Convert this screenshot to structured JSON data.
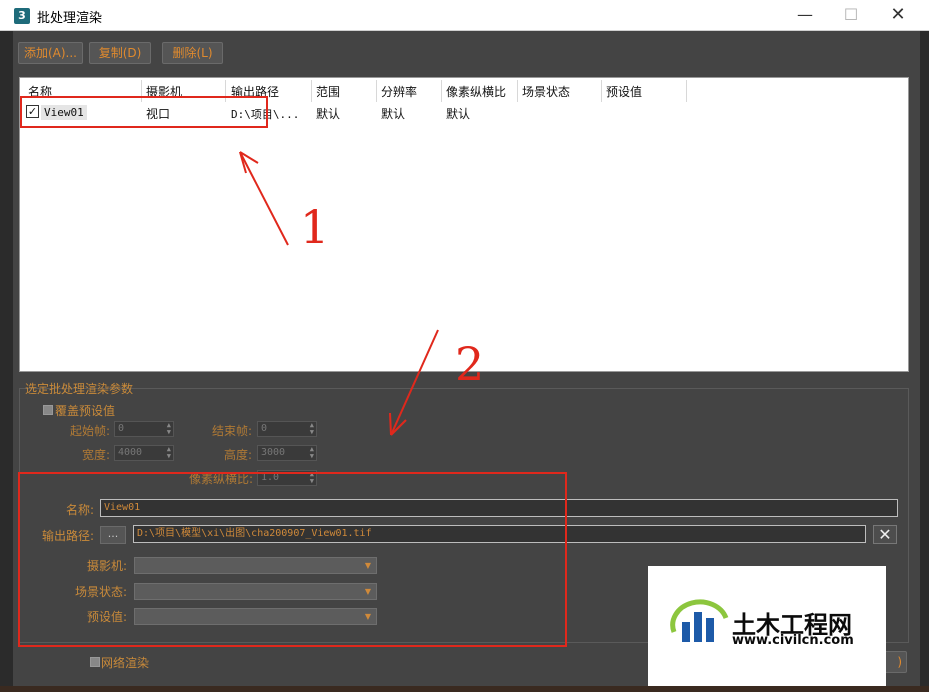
{
  "window": {
    "title": "批处理渲染",
    "icon_label": "3"
  },
  "toolbar": {
    "add_label": "添加(A)...",
    "copy_label": "复制(D)",
    "delete_label": "删除(L)"
  },
  "list": {
    "columns": [
      "名称",
      "摄影机",
      "输出路径",
      "范围",
      "分辨率",
      "像素纵横比",
      "场景状态",
      "预设值"
    ],
    "row": {
      "checked": "✓",
      "name": "View01",
      "camera": "视口",
      "output": "D:\\项目\\...",
      "range": "默认",
      "resolution": "默认",
      "aspect": "默认"
    }
  },
  "params": {
    "group_title": "选定批处理渲染参数",
    "override_label": "覆盖预设值",
    "start_frame_label": "起始帧:",
    "start_frame_value": "0",
    "end_frame_label": "结束帧:",
    "end_frame_value": "0",
    "width_label": "宽度:",
    "width_value": "4000",
    "height_label": "高度:",
    "height_value": "3000",
    "aspect_label": "像素纵横比:",
    "aspect_value": "1.0",
    "name_label": "名称:",
    "name_value": "View01",
    "output_label": "输出路径:",
    "output_button": "...",
    "output_value": "D:\\项目\\模型\\xi\\出图\\cha200907_View01.tif",
    "clear_button": "✕",
    "camera_label": "摄影机:",
    "scene_state_label": "场景状态:",
    "preset_label": "预设值:",
    "network_label": "网络渲染",
    "render_partial": ")"
  },
  "annotations": {
    "num1": "1",
    "num2": "2"
  },
  "watermark": {
    "title": "土木工程网",
    "url": "www.civilcn.com"
  },
  "colors": {
    "accent": "#e08a2e",
    "annotation": "#e0281c",
    "dialog_bg": "#444444"
  }
}
